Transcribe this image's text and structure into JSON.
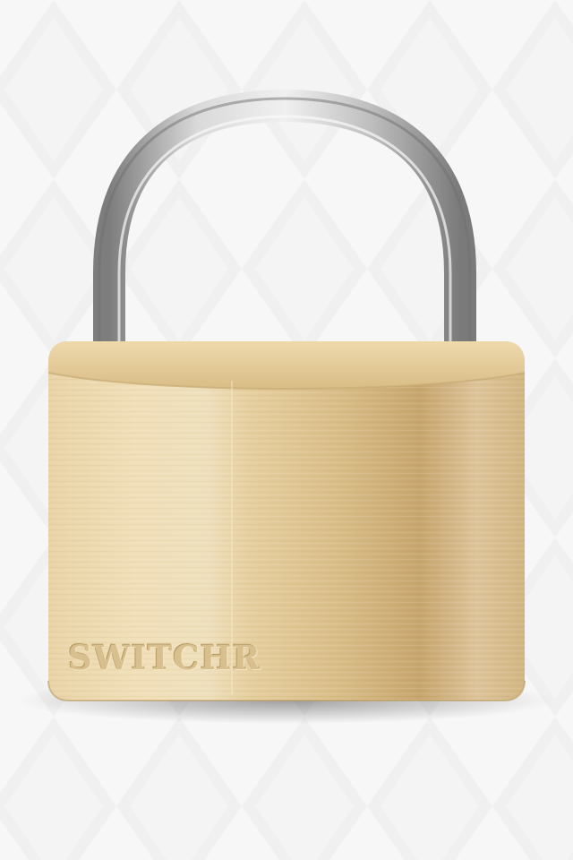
{
  "lock": {
    "brand_label": "SWITCHR"
  },
  "colors": {
    "background": "#f6f6f6",
    "background_pattern": "#ececec",
    "brass_light": "#f1e0b9",
    "brass_mid": "#dcc393",
    "brass_dark": "#c5a56c",
    "shackle_light": "#e9e9e9",
    "shackle_dark": "#8a8a8a"
  },
  "icons": {
    "padlock": "padlock-icon"
  }
}
